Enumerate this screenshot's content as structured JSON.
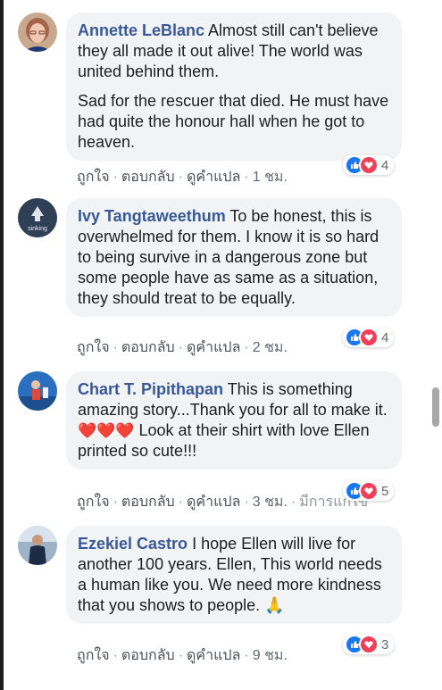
{
  "comments": [
    {
      "author": "Annette LeBlanc",
      "text1": " Almost still can't believe they all made it out alive! The world was united behind them.",
      "text2": "Sad for the rescuer that died. He must have had quite the honour hall when he got to heaven.",
      "like": "ถูกใจ",
      "reply": "ตอบกลับ",
      "translate": "ดูคำแปล",
      "time": "1 ชม.",
      "reaction_count": "4"
    },
    {
      "author": "Ivy Tangtaweethum",
      "avatar_text": "sinking",
      "text1": " To be honest, this is overwhelmed for them. I know it is so hard to being survive in a dangerous zone but some people have as same as a situation, they should treat to be equally.",
      "like": "ถูกใจ",
      "reply": "ตอบกลับ",
      "translate": "ดูคำแปล",
      "time": "2 ชม.",
      "reaction_count": "4"
    },
    {
      "author": "Chart T. Pipithapan",
      "text1": " This is something amazing story...Thank you for all to make it. ",
      "hearts": "❤️❤️❤️",
      "text1b": " Look at their shirt with love Ellen printed so cute!!!",
      "like": "ถูกใจ",
      "reply": "ตอบกลับ",
      "translate": "ดูคำแปล",
      "time": "3 ชม.",
      "overflow": "มีการแก้ไข",
      "reaction_count": "5"
    },
    {
      "author": "Ezekiel Castro",
      "text1": " I hope Ellen will live for another 100 years. Ellen, This world needs a human like you. We need more kindness that you shows to people. ",
      "emoji": "🙏",
      "like": "ถูกใจ",
      "reply": "ตอบกลับ",
      "translate": "ดูคำแปล",
      "time": "9 ชม.",
      "reaction_count": "3"
    }
  ],
  "colors": {
    "author": "#385898",
    "bubble": "#f2f3f5",
    "like_reaction": "#1877f2",
    "love_reaction": "#f33e58"
  },
  "icons": {
    "like": "thumbs-up-icon",
    "love": "heart-icon"
  }
}
